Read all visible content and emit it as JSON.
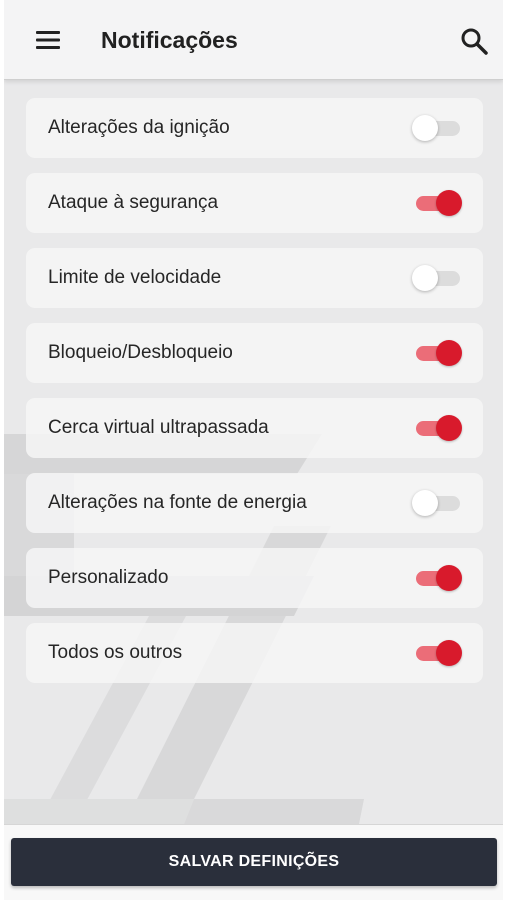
{
  "header": {
    "title": "Notificações",
    "menu_icon": "menu-icon",
    "search_icon": "search-icon"
  },
  "notifications": [
    {
      "label": "Alterações da ignição",
      "enabled": false
    },
    {
      "label": "Ataque à segurança",
      "enabled": true
    },
    {
      "label": "Limite de velocidade",
      "enabled": false
    },
    {
      "label": "Bloqueio/Desbloqueio",
      "enabled": true
    },
    {
      "label": "Cerca virtual ultrapassada",
      "enabled": true
    },
    {
      "label": "Alterações na fonte de energia",
      "enabled": false
    },
    {
      "label": "Personalizado",
      "enabled": true
    },
    {
      "label": "Todos os outros",
      "enabled": true
    }
  ],
  "footer": {
    "save_label": "SALVAR DEFINIÇÕES"
  },
  "colors": {
    "accent": "#d81a2c",
    "accent_track": "#eb6d78",
    "button_bg": "#2a2f3b"
  }
}
